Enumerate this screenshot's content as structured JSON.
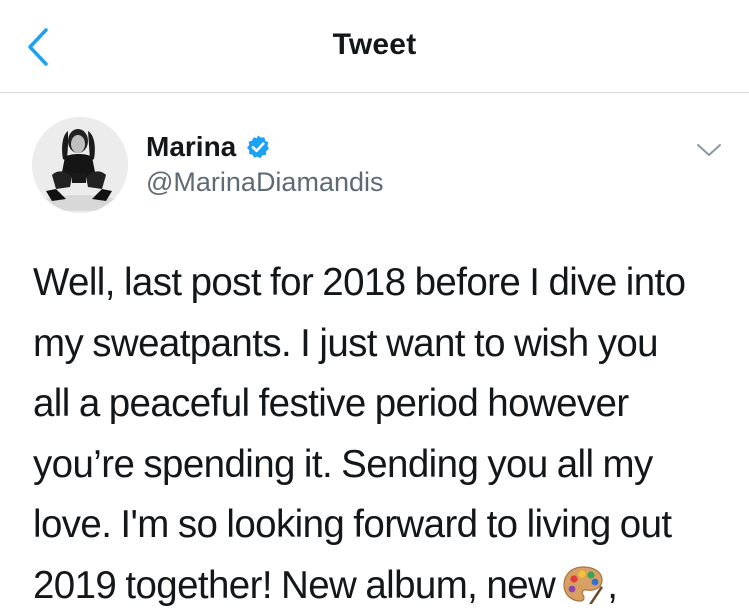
{
  "header": {
    "title": "Tweet"
  },
  "icons": {
    "back": "chevron-left-icon",
    "verified": "verified-badge-icon",
    "more": "chevron-down-icon",
    "emoji": "artist-palette-emoji"
  },
  "colors": {
    "accent": "#1da1f2",
    "handle": "#5f6a74",
    "text": "#14171a",
    "divider": "#d3d7da"
  },
  "tweet": {
    "display_name": "Marina",
    "handle": "@MarinaDiamandis",
    "lines": [
      "Well, last post for 2018 before I dive into",
      "my sweatpants. I just want to wish you",
      "all a peaceful festive period however",
      "you’re spending it. Sending you all my",
      "love. I'm so looking forward to living out",
      "2019 together! New album, new"
    ],
    "trailing_punctuation": ","
  }
}
